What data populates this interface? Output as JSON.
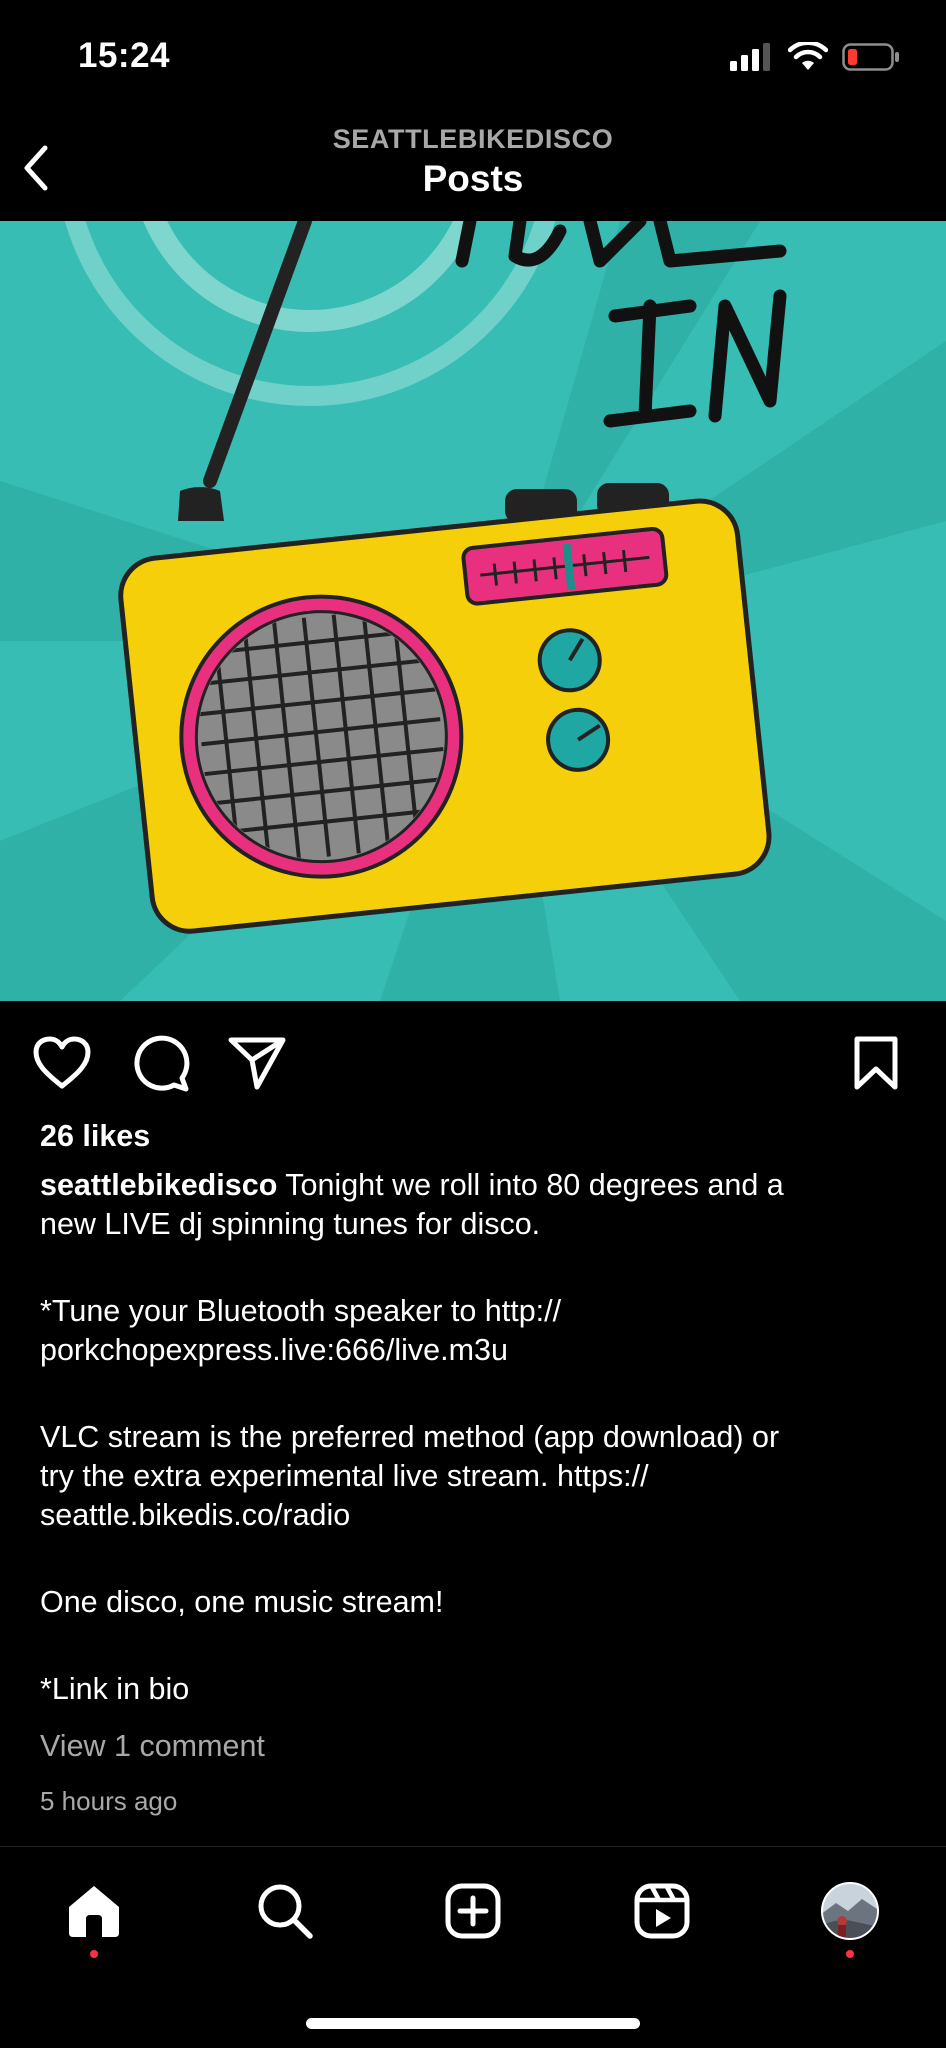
{
  "status_bar": {
    "time": "15:24",
    "signal_icon": "cellular-signal-icon",
    "wifi_icon": "wifi-icon",
    "battery_icon": "battery-low-icon"
  },
  "header": {
    "account": "SEATTLEBIKEDISCO",
    "title": "Posts"
  },
  "post": {
    "image_text": "TUNE IN",
    "likes": "26 likes",
    "username": "seattlebikedisco",
    "caption_lines": [
      " Tonight we roll into 80 degrees and a",
      "new LIVE dj spinning tunes for disco.",
      "",
      "*Tune your Bluetooth speaker to http://",
      "porkchopexpress.live:666/live.m3u",
      "",
      "VLC stream is the preferred method (app download) or",
      "try the extra experimental live stream.  https://",
      "seattle.bikedis.co/radio",
      "",
      "One disco, one music stream!",
      "",
      "*Link in bio"
    ],
    "view_comments": "View 1 comment",
    "timestamp": "5 hours ago"
  },
  "actions": [
    "heart-icon",
    "comment-icon",
    "share-icon",
    "bookmark-icon"
  ],
  "bottom_nav": [
    "home-icon",
    "search-icon",
    "create-icon",
    "reels-icon",
    "profile-avatar"
  ],
  "colors": {
    "background": "#000000",
    "image_teal": "#37bdb3",
    "radio_yellow": "#f5cf0a",
    "accent_pink": "#e8307e",
    "notification_red": "#ff3040",
    "muted_text": "#a8a8a8"
  }
}
